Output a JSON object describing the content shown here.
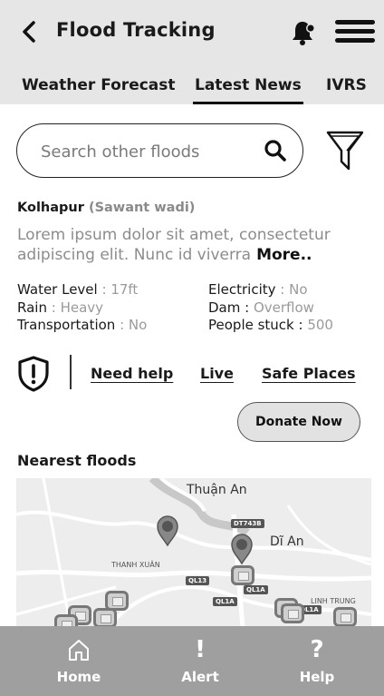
{
  "header": {
    "title": "Flood Tracking",
    "back_icon": "chevron-left-icon",
    "notification_icon": "bell-icon",
    "menu_icon": "hamburger-menu-icon"
  },
  "tabs": [
    {
      "label": "Weather Forecast",
      "active": false
    },
    {
      "label": "Latest News",
      "active": true
    },
    {
      "label": "IVRS",
      "active": false
    }
  ],
  "search": {
    "placeholder": "Search other floods",
    "value": "",
    "icon": "search-icon",
    "filter_icon": "filter-icon"
  },
  "news": {
    "location": "Kolhapur",
    "sub_location": "(Sawant wadi)",
    "description": "Lorem ipsum dolor sit amet, consectetur adipiscing elit. Nunc id viverra",
    "more_label": "More..",
    "stats_left": [
      {
        "key": "Water Level",
        "sep": " : ",
        "value": "17ft"
      },
      {
        "key": "Rain",
        "sep": " : ",
        "value": "Heavy"
      },
      {
        "key": "Transportation",
        "sep": " : ",
        "value": "No"
      }
    ],
    "stats_right": [
      {
        "key": "Electricity",
        "sep": " : ",
        "value": "No"
      },
      {
        "key": "Dam",
        "sep": " : ",
        "value": "Overflow"
      },
      {
        "key": "People stuck",
        "sep": " : ",
        "value": "500"
      }
    ]
  },
  "actions": {
    "icon": "shield-alert-icon",
    "need_help": "Need help",
    "live": "Live",
    "safe_places": "Safe Places",
    "donate": "Donate Now"
  },
  "nearest": {
    "title": "Nearest floods",
    "map_labels": {
      "place1": "Thuận An",
      "place2": "Dĩ An",
      "place3": "THANH XUÂN",
      "place4": "LINH TRUNG"
    },
    "road_tags": [
      "DT743B",
      "QL13",
      "QL1A",
      "QL1A",
      "QL1A"
    ]
  },
  "bottom_nav": [
    {
      "label": "Home",
      "icon": "home-icon"
    },
    {
      "label": "Alert",
      "icon": "exclamation-icon"
    },
    {
      "label": "Help",
      "icon": "question-icon"
    }
  ]
}
